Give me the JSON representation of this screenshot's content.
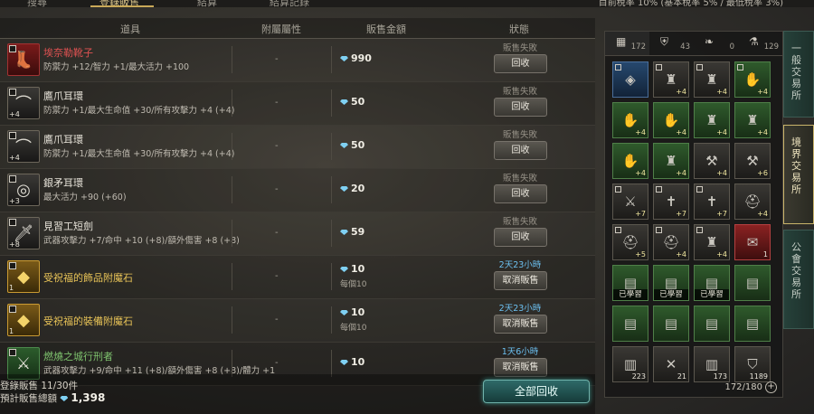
{
  "top_tabs": [
    {
      "label": "搜尋"
    },
    {
      "label": "登錄販售"
    },
    {
      "label": "結算"
    },
    {
      "label": "結算記錄"
    }
  ],
  "top_info": "目前稅率 10% (基本稅率 5% / 最低稅率 3%)",
  "headers": {
    "item": "道具",
    "attr": "附屬屬性",
    "price": "販售金額",
    "status": "狀態"
  },
  "rows": [
    {
      "icon": "boots-icon",
      "glyph": "👢",
      "frame": "red",
      "checked": false,
      "plus": "",
      "name": "埃奈勒靴子",
      "name_color": "red",
      "stats": "防禦力 +12/智力 +1/最大活力 +100",
      "attr": "-",
      "price": "990",
      "each": "",
      "status": "販售失敗",
      "status_type": "fail",
      "button": "回收"
    },
    {
      "icon": "necklace-icon",
      "glyph": "⌒",
      "frame": "dark",
      "checked": false,
      "plus": "+4",
      "name": "鷹爪耳環",
      "name_color": "white",
      "stats": "防禦力 +1/最大生命值 +30/所有攻擊力 +4 (+4)",
      "attr": "-",
      "price": "50",
      "each": "",
      "status": "販售失敗",
      "status_type": "fail",
      "button": "回收"
    },
    {
      "icon": "necklace-icon",
      "glyph": "⌒",
      "frame": "dark",
      "checked": false,
      "plus": "+4",
      "name": "鷹爪耳環",
      "name_color": "white",
      "stats": "防禦力 +1/最大生命值 +30/所有攻擊力 +4 (+4)",
      "attr": "-",
      "price": "50",
      "each": "",
      "status": "販售失敗",
      "status_type": "fail",
      "button": "回收"
    },
    {
      "icon": "earring-icon",
      "glyph": "◎",
      "frame": "dark",
      "checked": false,
      "plus": "+3",
      "name": "銀矛耳環",
      "name_color": "white",
      "stats": "最大活力 +90 (+60)",
      "attr": "-",
      "price": "20",
      "each": "",
      "status": "販售失敗",
      "status_type": "fail",
      "button": "回收"
    },
    {
      "icon": "dagger-icon",
      "glyph": "🗡",
      "frame": "dark",
      "checked": true,
      "plus": "+8",
      "name": "見習工短劍",
      "name_color": "white",
      "stats": "武器攻擊力 +7/命中 +10 (+8)/額外傷害 +8 (+8)",
      "attr": "-",
      "price": "59",
      "each": "",
      "status": "販售失敗",
      "status_type": "fail",
      "button": "回收"
    },
    {
      "icon": "enchant-stone-icon",
      "glyph": "◆",
      "frame": "gold",
      "checked": false,
      "plus": "1",
      "name": "受祝福的飾品附魔石",
      "name_color": "gold",
      "stats": "",
      "attr": "-",
      "price": "10",
      "each": "每個10",
      "status": "2天23小時",
      "status_type": "time",
      "button": "取消販售"
    },
    {
      "icon": "enchant-stone-icon",
      "glyph": "◆",
      "frame": "gold",
      "checked": false,
      "plus": "1",
      "name": "受祝福的裝備附魔石",
      "name_color": "gold",
      "stats": "",
      "attr": "-",
      "price": "10",
      "each": "每個10",
      "status": "2天23小時",
      "status_type": "time",
      "button": "取消販售"
    },
    {
      "icon": "sword-icon",
      "glyph": "⚔",
      "frame": "green",
      "checked": true,
      "plus": "",
      "name": "燃燒之城行刑者",
      "name_color": "green",
      "stats": "武器攻擊力 +9/命中 +11 (+8)/額外傷害 +8 (+8)/體力 +1",
      "attr": "-",
      "price": "10",
      "each": "",
      "status": "1天6小時",
      "status_type": "time",
      "button": "取消販售"
    }
  ],
  "footer": {
    "registered_label": "登錄販售",
    "registered_value": "11/30件",
    "total_label": "預計販售總額",
    "total_value": "1,398",
    "collect_all": "全部回收"
  },
  "inventory": {
    "tabs": [
      {
        "icon": "grid-icon",
        "glyph": "▦",
        "count": "172"
      },
      {
        "icon": "armor-icon",
        "glyph": "⛨",
        "count": "43"
      },
      {
        "icon": "leaf-icon",
        "glyph": "❧",
        "count": "0"
      },
      {
        "icon": "potion-icon",
        "glyph": "⚗",
        "count": "129"
      }
    ],
    "slots": [
      {
        "frame": "bl",
        "glyph": "◈",
        "badge": "",
        "label": "",
        "checked": true
      },
      {
        "frame": "",
        "glyph": "♜",
        "badge": "+4",
        "label": "",
        "checked": true
      },
      {
        "frame": "",
        "glyph": "♜",
        "badge": "+4",
        "label": "",
        "checked": true
      },
      {
        "frame": "gr",
        "glyph": "✋",
        "badge": "+4",
        "label": "",
        "checked": true
      },
      {
        "frame": "gr",
        "glyph": "✋",
        "badge": "+4",
        "label": "",
        "checked": false
      },
      {
        "frame": "gr",
        "glyph": "✋",
        "badge": "+4",
        "label": "",
        "checked": false
      },
      {
        "frame": "gr",
        "glyph": "♜",
        "badge": "+4",
        "label": "",
        "checked": false
      },
      {
        "frame": "gr",
        "glyph": "♜",
        "badge": "+4",
        "label": "",
        "checked": false
      },
      {
        "frame": "gr",
        "glyph": "✋",
        "badge": "+4",
        "label": "",
        "checked": false
      },
      {
        "frame": "gr",
        "glyph": "♜",
        "badge": "+4",
        "label": "",
        "checked": false
      },
      {
        "frame": "",
        "glyph": "⚒",
        "badge": "+4",
        "label": "",
        "checked": false
      },
      {
        "frame": "",
        "glyph": "⚒",
        "badge": "+6",
        "label": "",
        "checked": false
      },
      {
        "frame": "",
        "glyph": "⚔",
        "badge": "+7",
        "label": "",
        "checked": true
      },
      {
        "frame": "",
        "glyph": "✝",
        "badge": "+7",
        "label": "",
        "checked": true
      },
      {
        "frame": "",
        "glyph": "✝",
        "badge": "+7",
        "label": "",
        "checked": true
      },
      {
        "frame": "",
        "glyph": "⛑",
        "badge": "+4",
        "label": "",
        "checked": false
      },
      {
        "frame": "",
        "glyph": "⛑",
        "badge": "+5",
        "label": "",
        "checked": true
      },
      {
        "frame": "",
        "glyph": "⛑",
        "badge": "+4",
        "label": "",
        "checked": true
      },
      {
        "frame": "",
        "glyph": "♜",
        "badge": "+4",
        "label": "",
        "checked": true
      },
      {
        "frame": "rd",
        "glyph": "✉",
        "badge": "1",
        "label": "",
        "checked": false
      },
      {
        "frame": "gr",
        "glyph": "▤",
        "badge": "",
        "label": "已學習",
        "checked": false
      },
      {
        "frame": "gr",
        "glyph": "▤",
        "badge": "",
        "label": "已學習",
        "checked": false
      },
      {
        "frame": "gr",
        "glyph": "▤",
        "badge": "",
        "label": "已學習",
        "checked": false
      },
      {
        "frame": "gr",
        "glyph": "▤",
        "badge": "",
        "label": "",
        "checked": false
      },
      {
        "frame": "gr",
        "glyph": "▤",
        "badge": "",
        "label": "",
        "checked": false
      },
      {
        "frame": "gr",
        "glyph": "▤",
        "badge": "",
        "label": "",
        "checked": false
      },
      {
        "frame": "gr",
        "glyph": "▤",
        "badge": "",
        "label": "",
        "checked": false
      },
      {
        "frame": "gr",
        "glyph": "▤",
        "badge": "",
        "label": "",
        "checked": false
      },
      {
        "frame": "",
        "glyph": "▥",
        "badge": "223",
        "label": "",
        "checked": false
      },
      {
        "frame": "",
        "glyph": "✕",
        "badge": "21",
        "label": "",
        "checked": false
      },
      {
        "frame": "",
        "glyph": "▥",
        "badge": "173",
        "label": "",
        "checked": false
      },
      {
        "frame": "",
        "glyph": "⛉",
        "badge": "1189",
        "label": "",
        "checked": false
      }
    ],
    "capacity": "172/180",
    "expand": "+"
  },
  "side_tabs": [
    {
      "label": "一般交易所"
    },
    {
      "label": "境界交易所"
    },
    {
      "label": "公會交易所"
    }
  ],
  "colors": {
    "accent_gold": "#c9a958",
    "time_blue": "#6cc0f0",
    "rare_red": "#e05252",
    "rare_gold": "#e8c357",
    "rare_green": "#7fc46e"
  }
}
